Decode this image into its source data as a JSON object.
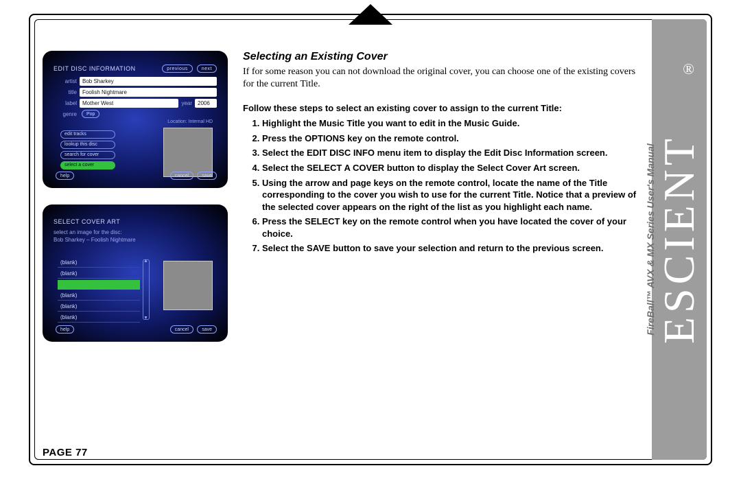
{
  "section_title": "Selecting an Existing Cover",
  "intro": "If for some reason you can not download the original cover, you can choose one of the existing covers for the current Title.",
  "steps_lead": "Follow these steps to select an existing cover to assign to the current Title:",
  "steps": [
    "Highlight the Music Title you want to edit in the Music Guide.",
    "Press the OPTIONS key on the remote control.",
    "Select the EDIT DISC INFO menu item to display the Edit Disc Information screen.",
    "Select the SELECT A COVER button to display the Select Cover Art screen.",
    "Using the arrow and page keys on the remote control, locate the name of the Title corresponding to the cover you wish to use for the current Title. Notice that a preview of the selected cover appears on the right of the list as you highlight each name.",
    "Press the SELECT key on the remote control when you have located the cover of your choice.",
    "Select the SAVE button to save your selection and return to the previous screen."
  ],
  "page_label": "PAGE 77",
  "brand": "ESCIENT",
  "brand_reg": "®",
  "brand_sub": "FireBall™ AVX & MX Series User's Manual",
  "shot1": {
    "header": "EDIT DISC INFORMATION",
    "prev": "previous",
    "next": "next",
    "fields": {
      "artist_label": "artist",
      "artist": "Bob Sharkey",
      "title_label": "title",
      "title": "Foolish Nightmare",
      "label_label": "label",
      "label": "Mother West",
      "year_label": "year",
      "year": "2006",
      "genre_label": "genre",
      "genre": "Pop"
    },
    "location": "Location: Internal HD",
    "buttons": [
      "edit tracks",
      "lookup this disc",
      "search for cover",
      "select a cover"
    ],
    "active_index": 3,
    "footer": {
      "help": "help",
      "cancel": "cancel",
      "save": "save"
    }
  },
  "shot2": {
    "header": "SELECT COVER ART",
    "sub1": "select an image for the disc:",
    "sub2": "Bob Sharkey – Foolish Nightmare",
    "rows": [
      "(blank)",
      "(blank)",
      "",
      "(blank)",
      "(blank)",
      "(blank)"
    ],
    "selected_index": 2,
    "footer": {
      "help": "help",
      "cancel": "cancel",
      "save": "save"
    }
  }
}
